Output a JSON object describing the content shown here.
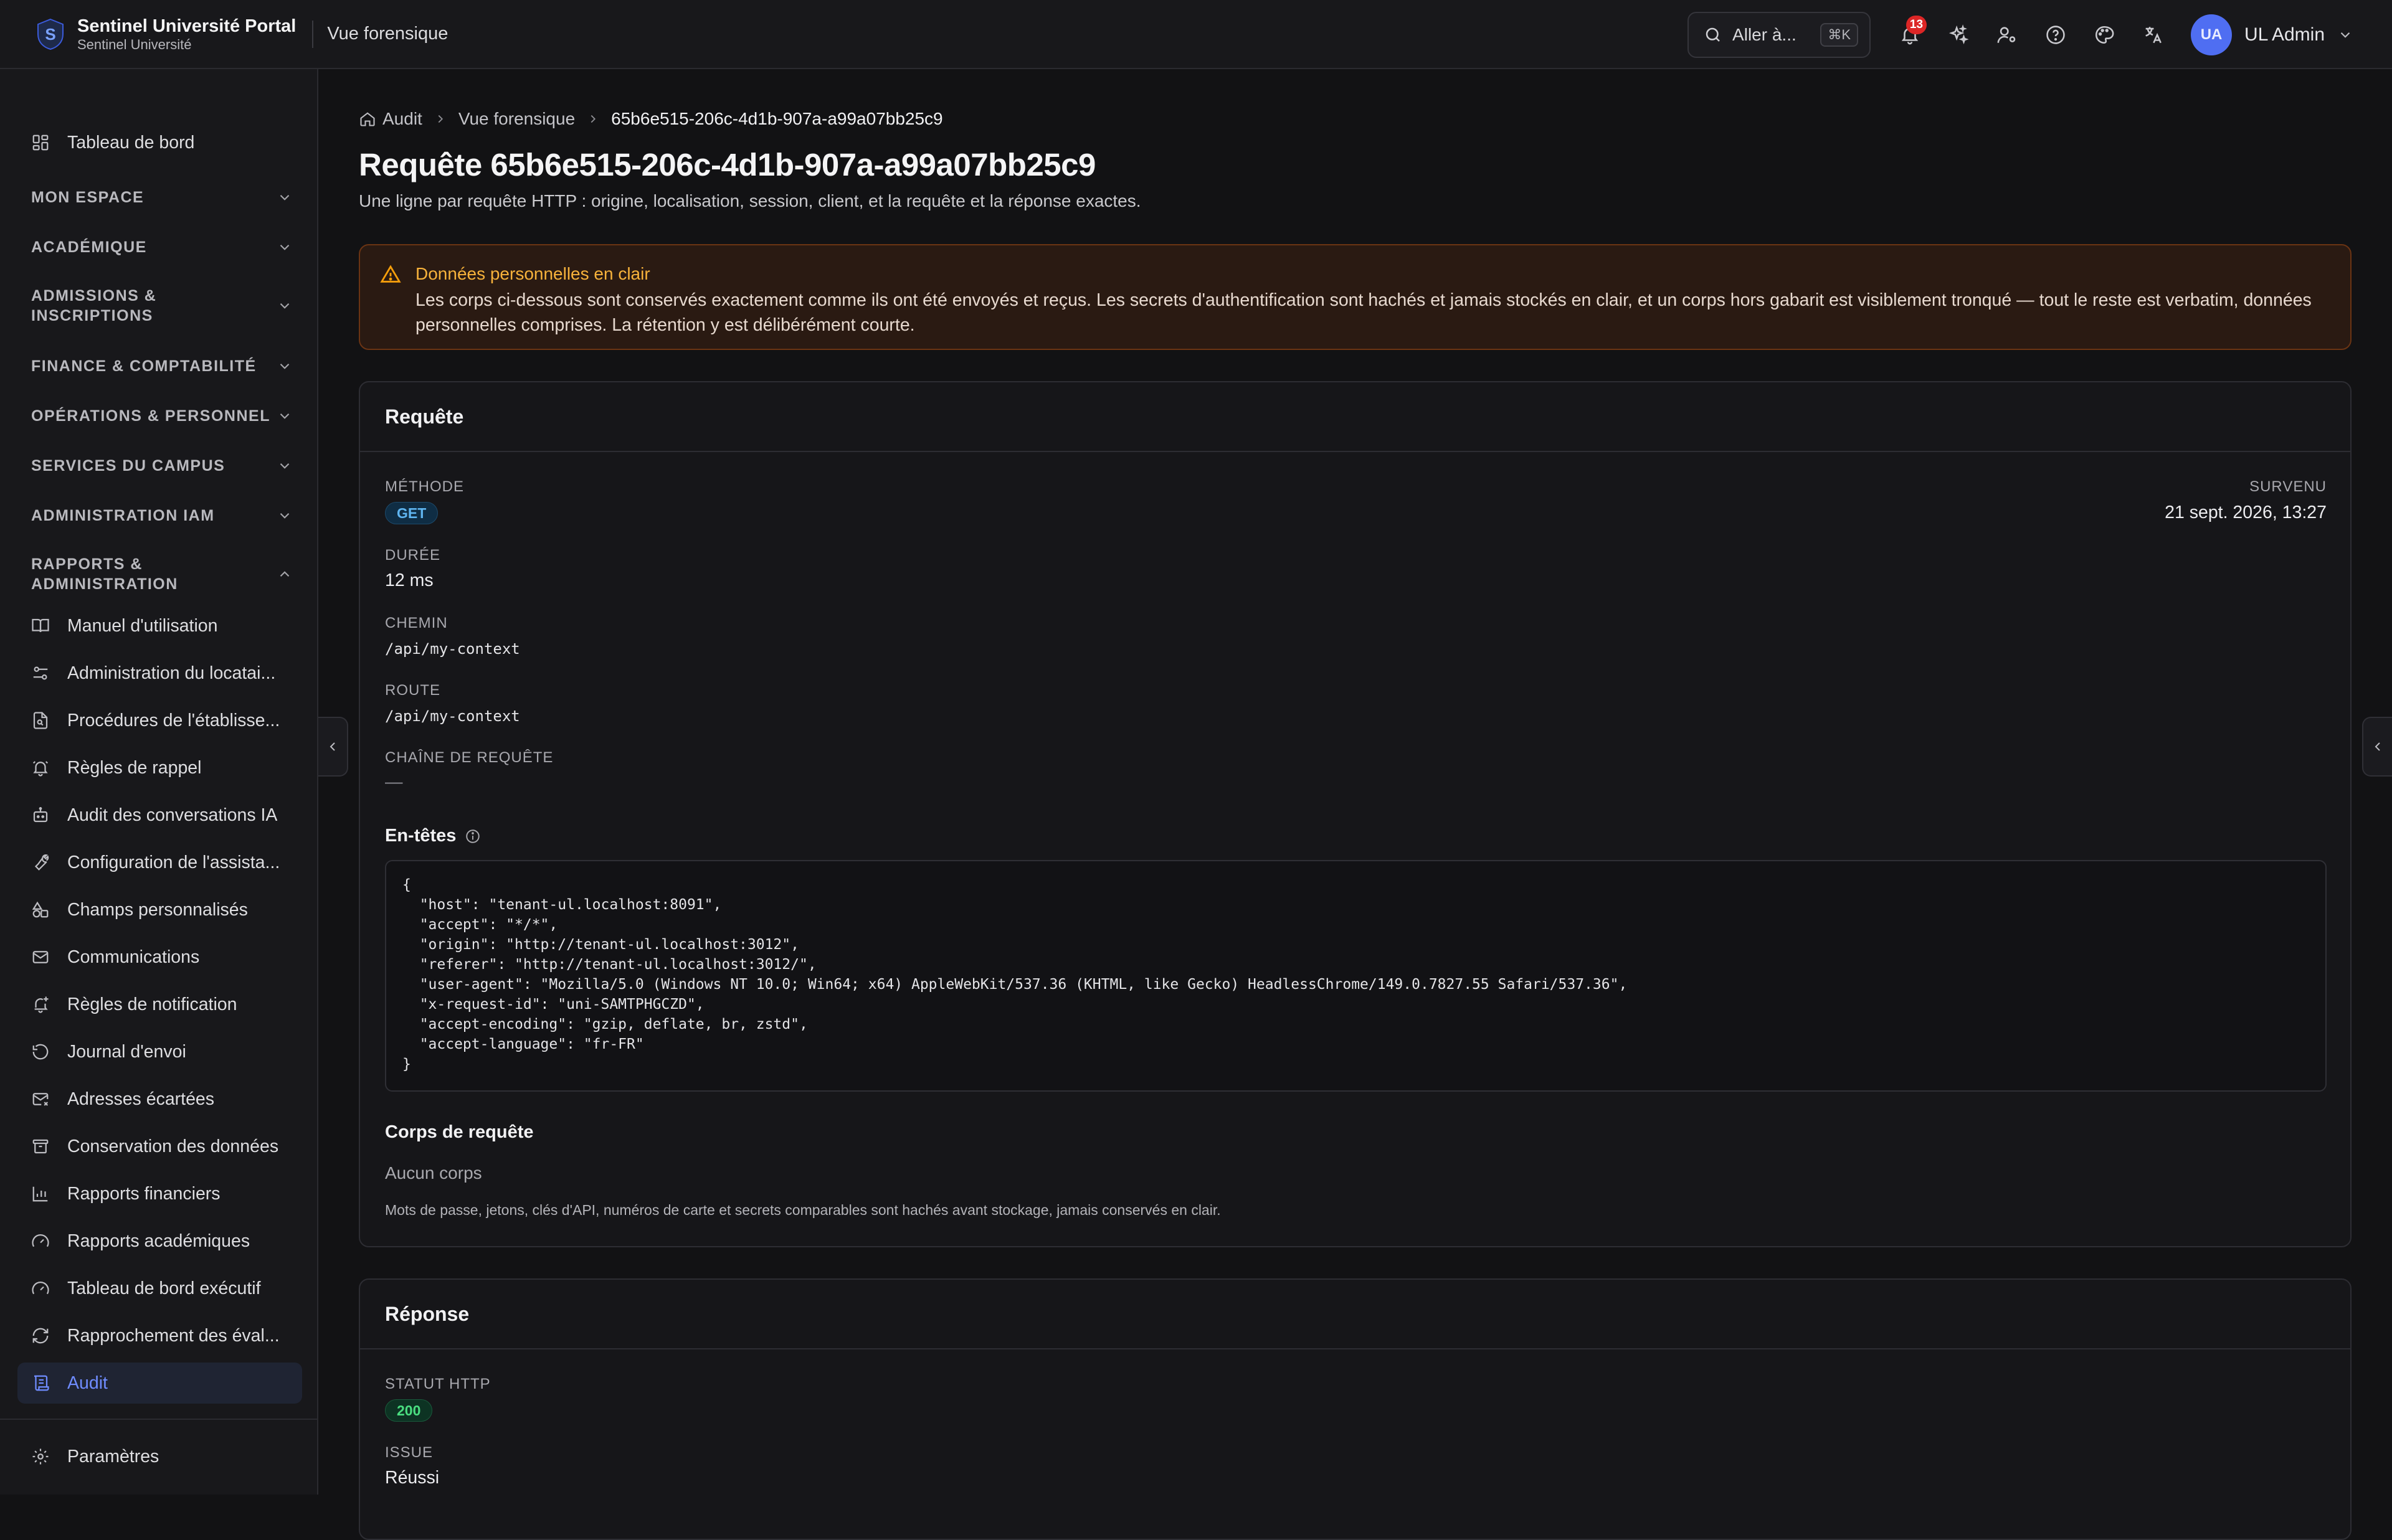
{
  "header": {
    "app_name": "Sentinel Université Portal",
    "org_name": "Sentinel Université",
    "context": "Vue forensique",
    "search_label": "Aller à...",
    "search_shortcut": "⌘K",
    "notification_count": "13",
    "user_initials": "UA",
    "user_name": "UL Admin"
  },
  "sidebar": {
    "dashboard": "Tableau de bord",
    "sections": [
      "MON ESPACE",
      "ACADÉMIQUE",
      "ADMISSIONS & INSCRIPTIONS",
      "FINANCE & COMPTABILITÉ",
      "OPÉRATIONS & PERSONNEL",
      "SERVICES DU CAMPUS",
      "ADMINISTRATION IAM",
      "RAPPORTS & ADMINISTRATION"
    ],
    "items": [
      "Manuel d'utilisation",
      "Administration du locatai...",
      "Procédures de l'établisse...",
      "Règles de rappel",
      "Audit des conversations IA",
      "Configuration de l'assista...",
      "Champs personnalisés",
      "Communications",
      "Règles de notification",
      "Journal d'envoi",
      "Adresses écartées",
      "Conservation des données",
      "Rapports financiers",
      "Rapports académiques",
      "Tableau de bord exécutif",
      "Rapprochement des éval...",
      "Audit"
    ],
    "settings": "Paramètres"
  },
  "breadcrumb": {
    "root": "Audit",
    "middle": "Vue forensique",
    "current": "65b6e515-206c-4d1b-907a-a99a07bb25c9"
  },
  "page": {
    "title": "Requête 65b6e515-206c-4d1b-907a-a99a07bb25c9",
    "description": "Une ligne par requête HTTP : origine, localisation, session, client, et la requête et la réponse exactes."
  },
  "alert": {
    "title": "Données personnelles en clair",
    "body": "Les corps ci-dessous sont conservés exactement comme ils ont été envoyés et reçus. Les secrets d'authentification sont hachés et jamais stockés en clair, et un corps hors gabarit est visiblement tronqué — tout le reste est verbatim, données personnelles comprises. La rétention y est délibérément courte."
  },
  "request": {
    "title": "Requête",
    "method_label": "MÉTHODE",
    "method": "GET",
    "occurred_label": "SURVENU",
    "occurred": "21 sept. 2026, 13:27",
    "duration_label": "DURÉE",
    "duration": "12 ms",
    "path_label": "CHEMIN",
    "path": "/api/my-context",
    "route_label": "ROUTE",
    "route": "/api/my-context",
    "query_label": "CHAÎNE DE REQUÊTE",
    "query": "—",
    "headers_title": "En-têtes",
    "headers_lines": [
      "{",
      "  \"host\": \"tenant-ul.localhost:8091\",",
      "  \"accept\": \"*/*\",",
      "  \"origin\": \"http://tenant-ul.localhost:3012\",",
      "  \"referer\": \"http://tenant-ul.localhost:3012/\",",
      "  \"user-agent\": \"Mozilla/5.0 (Windows NT 10.0; Win64; x64) AppleWebKit/537.36 (KHTML, like Gecko) HeadlessChrome/149.0.7827.55 Safari/537.36\",",
      "  \"x-request-id\": \"uni-SAMTPHGCZD\",",
      "  \"accept-encoding\": \"gzip, deflate, br, zstd\",",
      "  \"accept-language\": \"fr-FR\"",
      "}"
    ],
    "body_title": "Corps de requête",
    "body_empty": "Aucun corps",
    "body_note": "Mots de passe, jetons, clés d'API, numéros de carte et secrets comparables sont hachés avant stockage, jamais conservés en clair."
  },
  "response": {
    "title": "Réponse",
    "status_label": "STATUT HTTP",
    "status": "200",
    "outcome_label": "ISSUE",
    "outcome": "Réussi"
  }
}
